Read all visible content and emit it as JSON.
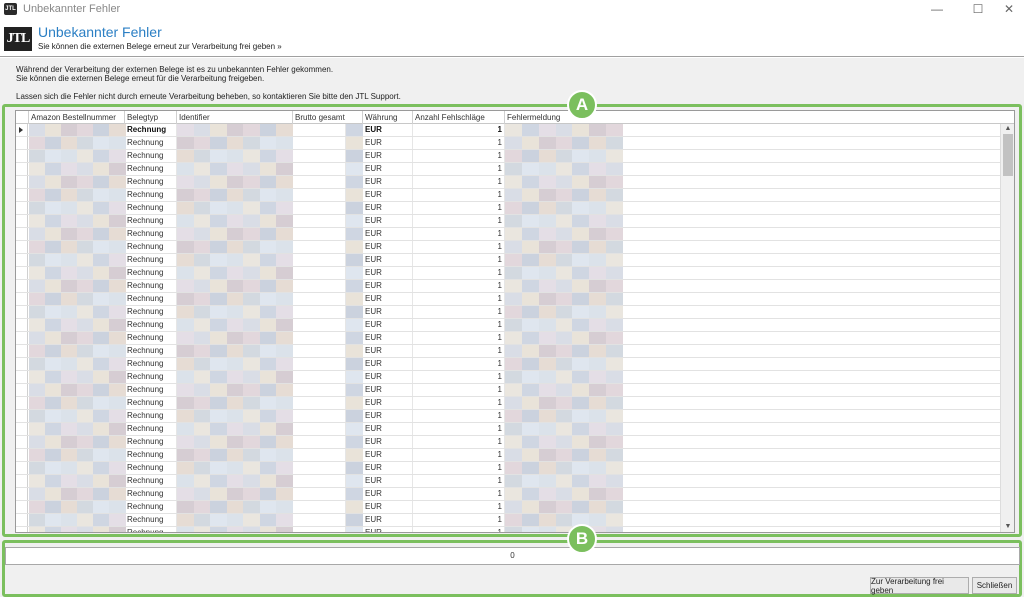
{
  "window": {
    "logo_text": "JTL",
    "title": "Unbekannter Fehler",
    "minimize": "—",
    "maximize": "☐",
    "close": "✕"
  },
  "header": {
    "logo_text": "JTL",
    "title": "Unbekannter Fehler",
    "subtitle": "Sie können die externen Belege erneut zur Verarbeitung frei geben »"
  },
  "message": {
    "line1": "Während der Verarbeitung der externen Belege ist es zu unbekannten Fehler gekommen.",
    "line2": "Sie können die externen Belege erneut für die Verarbeitung freigeben.",
    "line3": "Lassen sich die Fehler nicht durch erneute Verarbeitung beheben, so kontaktieren Sie bitte den JTL Support."
  },
  "grid": {
    "columns": [
      "Amazon Bestellnummer",
      "Belegtyp",
      "Identifier",
      "Brutto gesamt",
      "Währung",
      "Anzahl Fehlschläge",
      "Fehlermeldung"
    ],
    "row_type": "Rechnung",
    "row_currency": "EUR",
    "row_fail_count": "1",
    "row_count_visible": 32,
    "scroll_up": "▲",
    "scroll_down": "▼"
  },
  "progress": {
    "value": "0"
  },
  "buttons": {
    "release": "Zur Verarbeitung frei geben",
    "close": "Schließen"
  },
  "annotations": {
    "a": "A",
    "b": "B"
  },
  "colors": {
    "accent_title": "#2b7fc4",
    "annotation_green": "#7bbf5e"
  }
}
